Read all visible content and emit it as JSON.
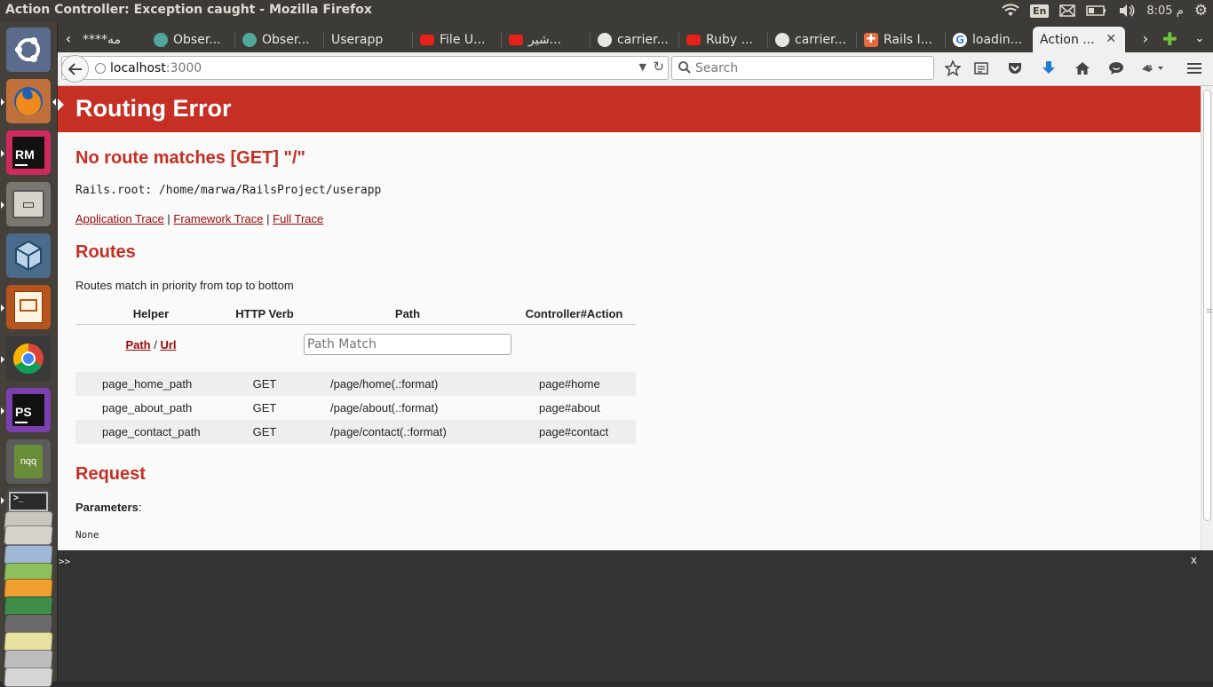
{
  "window": {
    "title": "Action Controller: Exception caught - Mozilla Firefox"
  },
  "system_tray": {
    "language": "En",
    "clock": "8:05 م"
  },
  "launcher": {
    "items": [
      {
        "name": "Ubuntu Dash",
        "icon": "ubuntu-logo-icon"
      },
      {
        "name": "Firefox",
        "icon": "firefox-icon"
      },
      {
        "name": "RubyMine",
        "icon": "rubymine-icon",
        "label": "RM"
      },
      {
        "name": "Files",
        "icon": "files-icon"
      },
      {
        "name": "VirtualBox",
        "icon": "virtualbox-icon"
      },
      {
        "name": "LibreOffice Impress",
        "icon": "impress-icon"
      },
      {
        "name": "Chrome",
        "icon": "chrome-icon"
      },
      {
        "name": "PhpStorm",
        "icon": "phpstorm-icon",
        "label": "PS"
      },
      {
        "name": "nqq",
        "icon": "notepadqq-icon",
        "label": "nqq"
      }
    ]
  },
  "tabs": [
    {
      "label": "****مه",
      "favicon": "generic"
    },
    {
      "label": "Obser...",
      "favicon": "globe"
    },
    {
      "label": "Obser...",
      "favicon": "globe"
    },
    {
      "label": "Userapp",
      "favicon": "none"
    },
    {
      "label": "File U...",
      "favicon": "youtube"
    },
    {
      "label": "شير...",
      "favicon": "youtube"
    },
    {
      "label": "carrier...",
      "favicon": "github"
    },
    {
      "label": "Ruby ...",
      "favicon": "youtube"
    },
    {
      "label": "carrier...",
      "favicon": "github"
    },
    {
      "label": "Rails I...",
      "favicon": "rails"
    },
    {
      "label": "loadin...",
      "favicon": "google"
    },
    {
      "label": "Action ...",
      "favicon": "none",
      "active": true
    }
  ],
  "nav": {
    "url_host": "localhost",
    "url_port": ":3000",
    "search_placeholder": "Search"
  },
  "page": {
    "header": "Routing Error",
    "error_title": "No route matches [GET] \"/\"",
    "rails_root": "Rails.root: /home/marwa/RailsProject/userapp",
    "trace_links": [
      "Application Trace",
      "Framework Trace",
      "Full Trace"
    ],
    "trace_sep": "|",
    "routes_heading": "Routes",
    "routes_note": "Routes match in priority from top to bottom",
    "routes_table": {
      "headers": [
        "Helper",
        "HTTP Verb",
        "Path",
        "Controller#Action"
      ],
      "filter": {
        "path_label": "Path",
        "slash": "/",
        "url_label": "Url",
        "placeholder": "Path Match"
      },
      "rows": [
        {
          "helper": "page_home_path",
          "verb": "GET",
          "path": "/page/home(.:format)",
          "action": "page#home"
        },
        {
          "helper": "page_about_path",
          "verb": "GET",
          "path": "/page/about(.:format)",
          "action": "page#about"
        },
        {
          "helper": "page_contact_path",
          "verb": "GET",
          "path": "/page/contact(.:format)",
          "action": "page#contact"
        }
      ]
    },
    "request_heading": "Request",
    "parameters_label": "Parameters",
    "parameters_colon": ":",
    "parameters_value": "None"
  },
  "console": {
    "prompt": ">>",
    "close": "x"
  },
  "colors": {
    "rails_red": "#c52f24",
    "link_red": "#980905",
    "console_bg": "#333333"
  }
}
